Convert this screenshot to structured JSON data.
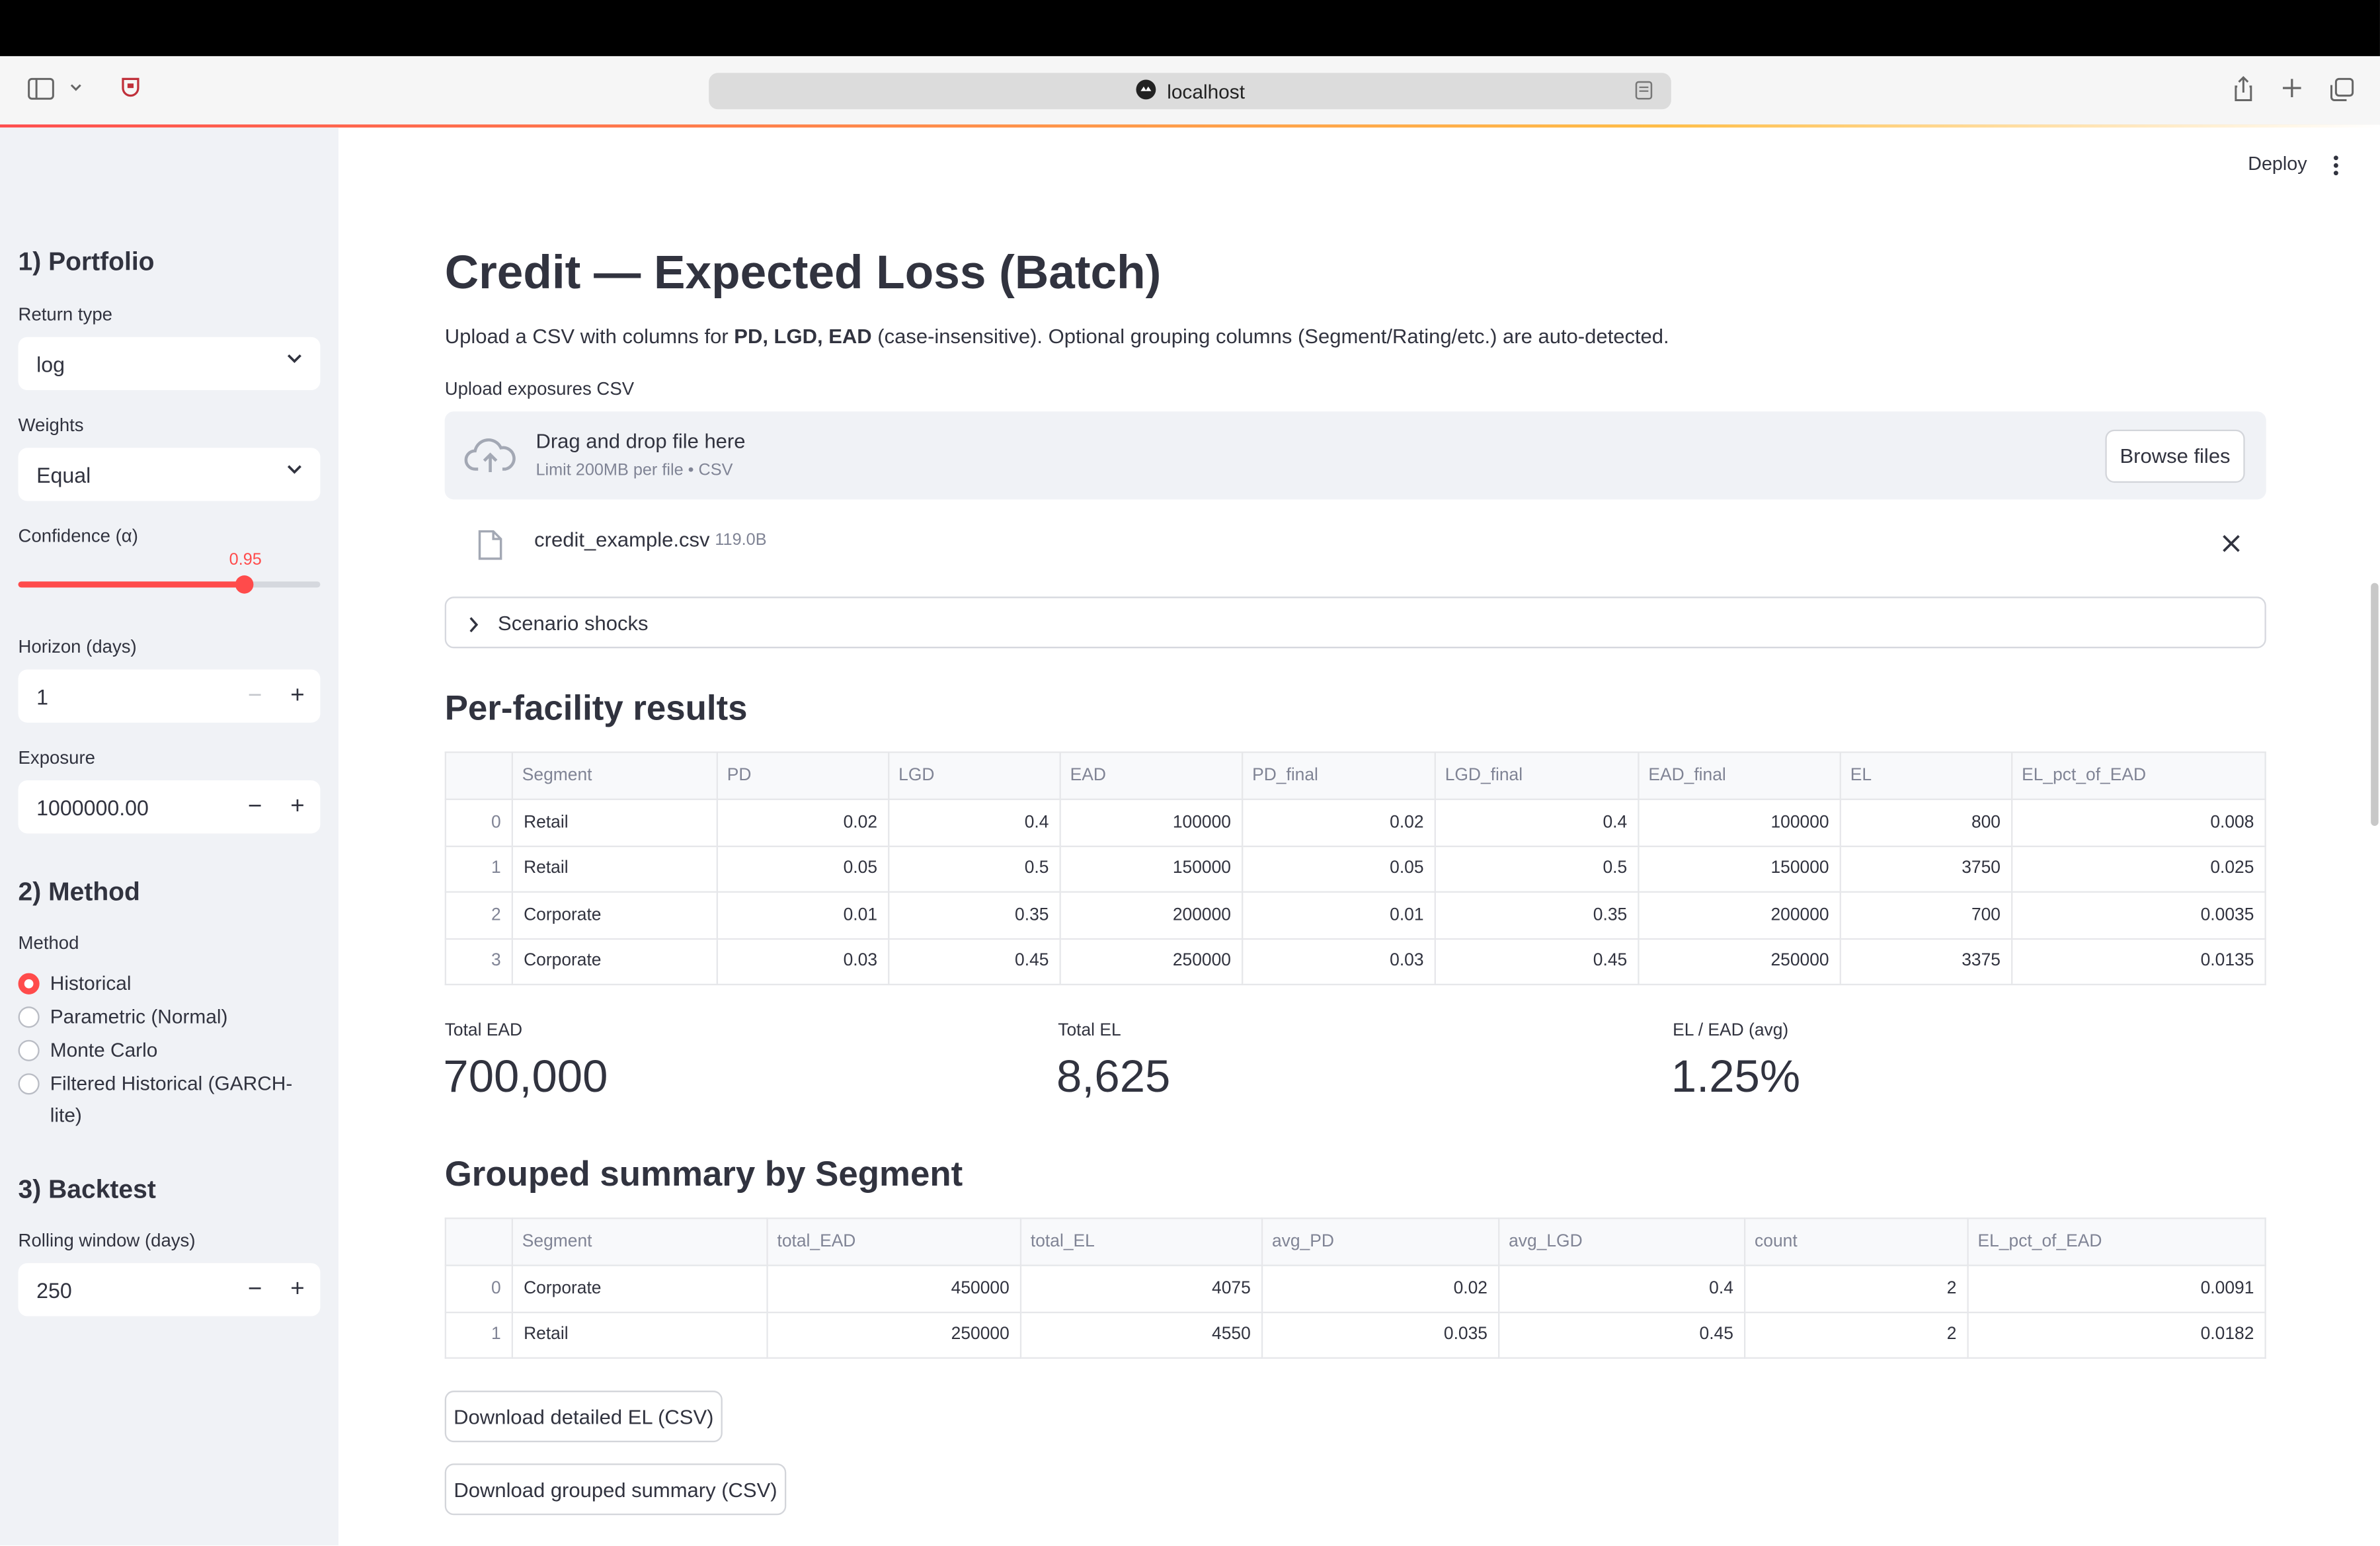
{
  "browser": {
    "url": "localhost"
  },
  "header": {
    "deploy_label": "Deploy"
  },
  "sidebar": {
    "portfolio_heading": "1) Portfolio",
    "return_type_label": "Return type",
    "return_type_value": "log",
    "weights_label": "Weights",
    "weights_value": "Equal",
    "confidence_label": "Confidence (α)",
    "confidence_value": "0.95",
    "confidence_fraction": 0.75,
    "horizon_label": "Horizon (days)",
    "horizon_value": "1",
    "exposure_label": "Exposure",
    "exposure_value": "1000000.00",
    "method_heading": "2) Method",
    "method_label": "Method",
    "methods": [
      {
        "label": "Historical",
        "selected": true
      },
      {
        "label": "Parametric (Normal)",
        "selected": false
      },
      {
        "label": "Monte Carlo",
        "selected": false
      },
      {
        "label": "Filtered Historical (GARCH-lite)",
        "selected": false
      }
    ],
    "backtest_heading": "3) Backtest",
    "rolling_label": "Rolling window (days)",
    "rolling_value": "250"
  },
  "main": {
    "title": "Credit — Expected Loss (Batch)",
    "intro_pre": "Upload a CSV with columns for ",
    "intro_bold": "PD, LGD, EAD",
    "intro_post": " (case-insensitive). Optional grouping columns (Segment/Rating/etc.) are auto-detected.",
    "upload_label": "Upload exposures CSV",
    "drop_title": "Drag and drop file here",
    "drop_sub": "Limit 200MB per file • CSV",
    "browse_label": "Browse files",
    "file_name": "credit_example.csv",
    "file_size": "119.0B",
    "expander_label": "Scenario shocks",
    "facility_heading": "Per-facility results",
    "facility_columns": [
      "",
      "Segment",
      "PD",
      "LGD",
      "EAD",
      "PD_final",
      "LGD_final",
      "EAD_final",
      "EL",
      "EL_pct_of_EAD"
    ],
    "facility_rows": [
      [
        "0",
        "Retail",
        "0.02",
        "0.4",
        "100000",
        "0.02",
        "0.4",
        "100000",
        "800",
        "0.008"
      ],
      [
        "1",
        "Retail",
        "0.05",
        "0.5",
        "150000",
        "0.05",
        "0.5",
        "150000",
        "3750",
        "0.025"
      ],
      [
        "2",
        "Corporate",
        "0.01",
        "0.35",
        "200000",
        "0.01",
        "0.35",
        "200000",
        "700",
        "0.0035"
      ],
      [
        "3",
        "Corporate",
        "0.03",
        "0.45",
        "250000",
        "0.03",
        "0.45",
        "250000",
        "3375",
        "0.0135"
      ]
    ],
    "metrics": [
      {
        "label": "Total EAD",
        "value": "700,000"
      },
      {
        "label": "Total EL",
        "value": "8,625"
      },
      {
        "label": "EL / EAD (avg)",
        "value": "1.25%"
      }
    ],
    "grouped_heading": "Grouped summary by Segment",
    "grouped_columns": [
      "",
      "Segment",
      "total_EAD",
      "total_EL",
      "avg_PD",
      "avg_LGD",
      "count",
      "EL_pct_of_EAD"
    ],
    "grouped_rows": [
      [
        "0",
        "Corporate",
        "450000",
        "4075",
        "0.02",
        "0.4",
        "2",
        "0.0091"
      ],
      [
        "1",
        "Retail",
        "250000",
        "4550",
        "0.035",
        "0.45",
        "2",
        "0.0182"
      ]
    ],
    "download_detailed": "Download detailed EL (CSV)",
    "download_grouped": "Download grouped summary (CSV)"
  },
  "colors": {
    "accent": "#ff4b4b",
    "sidebar_bg": "#f0f2f6",
    "text": "#31333f"
  }
}
